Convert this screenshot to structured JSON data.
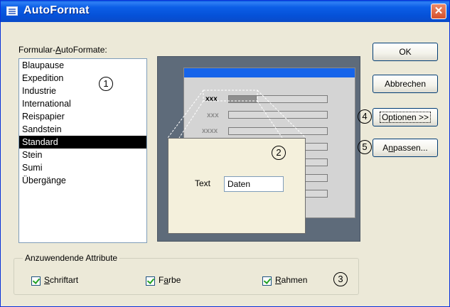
{
  "window": {
    "title": "AutoFormat",
    "close_glyph": "✕"
  },
  "autoformats": {
    "label_before": "Formular-",
    "label_accel": "A",
    "label_after": "utoFormate:",
    "items": [
      "Blaupause",
      "Expedition",
      "Industrie",
      "International",
      "Reispapier",
      "Sandstein",
      "Standard",
      "Stein",
      "Sumi",
      "Übergänge"
    ],
    "selected": "Standard"
  },
  "preview": {
    "row_labels": [
      "xxx",
      "xxx",
      "xxxx"
    ],
    "text_label": "Text",
    "field_value": "Daten"
  },
  "buttons": {
    "ok": "OK",
    "cancel": "Abbrechen",
    "options": "Optionen >>",
    "customize_accel": "n",
    "customize_before": "A",
    "customize_after": "passen..."
  },
  "attributes": {
    "legend": "Anzuwendende Attribute",
    "font": {
      "accel": "S",
      "rest": "chriftart",
      "checked": true
    },
    "color": {
      "before": "F",
      "accel": "a",
      "after": "rbe",
      "checked": true
    },
    "border": {
      "accel": "R",
      "rest": "ahmen",
      "checked": true
    }
  },
  "callouts": [
    "1",
    "2",
    "3",
    "4",
    "5"
  ]
}
